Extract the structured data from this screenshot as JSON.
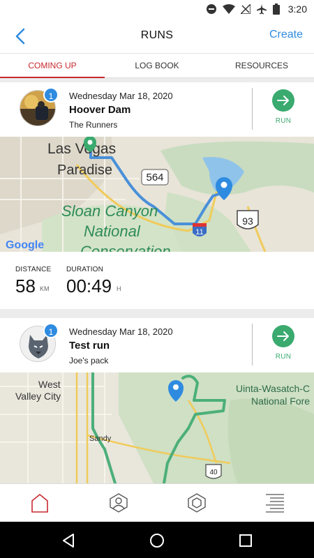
{
  "status_bar": {
    "time": "3:20"
  },
  "header": {
    "title": "RUNS",
    "back_icon": "chevron-left-icon",
    "create_label": "Create"
  },
  "tabs": [
    {
      "label": "COMING UP",
      "active": true
    },
    {
      "label": "LOG BOOK",
      "active": false
    },
    {
      "label": "RESOURCES",
      "active": false
    }
  ],
  "runs": [
    {
      "date": "Wednesday Mar 18, 2020",
      "name": "Hoover Dam",
      "group": "The Runners",
      "badge": "1",
      "run_label": "RUN",
      "map": {
        "place_labels": [
          "Las Vegas",
          "Paradise",
          "Sloan Canyon",
          "National",
          "Conservation"
        ],
        "road_shields": [
          "564",
          "11",
          "93"
        ],
        "attribution": "Google"
      },
      "distance_label": "DISTANCE",
      "distance_value": "58",
      "distance_unit": "KM",
      "duration_label": "DURATION",
      "duration_value": "00:49",
      "duration_unit": "H"
    },
    {
      "date": "Wednesday Mar 18, 2020",
      "name": "Test run",
      "group": "Joe's pack",
      "badge": "1",
      "run_label": "RUN",
      "map": {
        "place_labels": [
          "West",
          "Valley City",
          "Sandy",
          "Uinta-Wasatch-C",
          "National Fore"
        ],
        "road_shields": [
          "40"
        ]
      }
    }
  ],
  "bottom_nav": [
    "home-icon",
    "profile-icon",
    "hexagon-icon",
    "menu-icon"
  ],
  "colors": {
    "accent": "#2e8be0",
    "active_tab": "#c8282f",
    "run_green": "#3aaa6f"
  }
}
